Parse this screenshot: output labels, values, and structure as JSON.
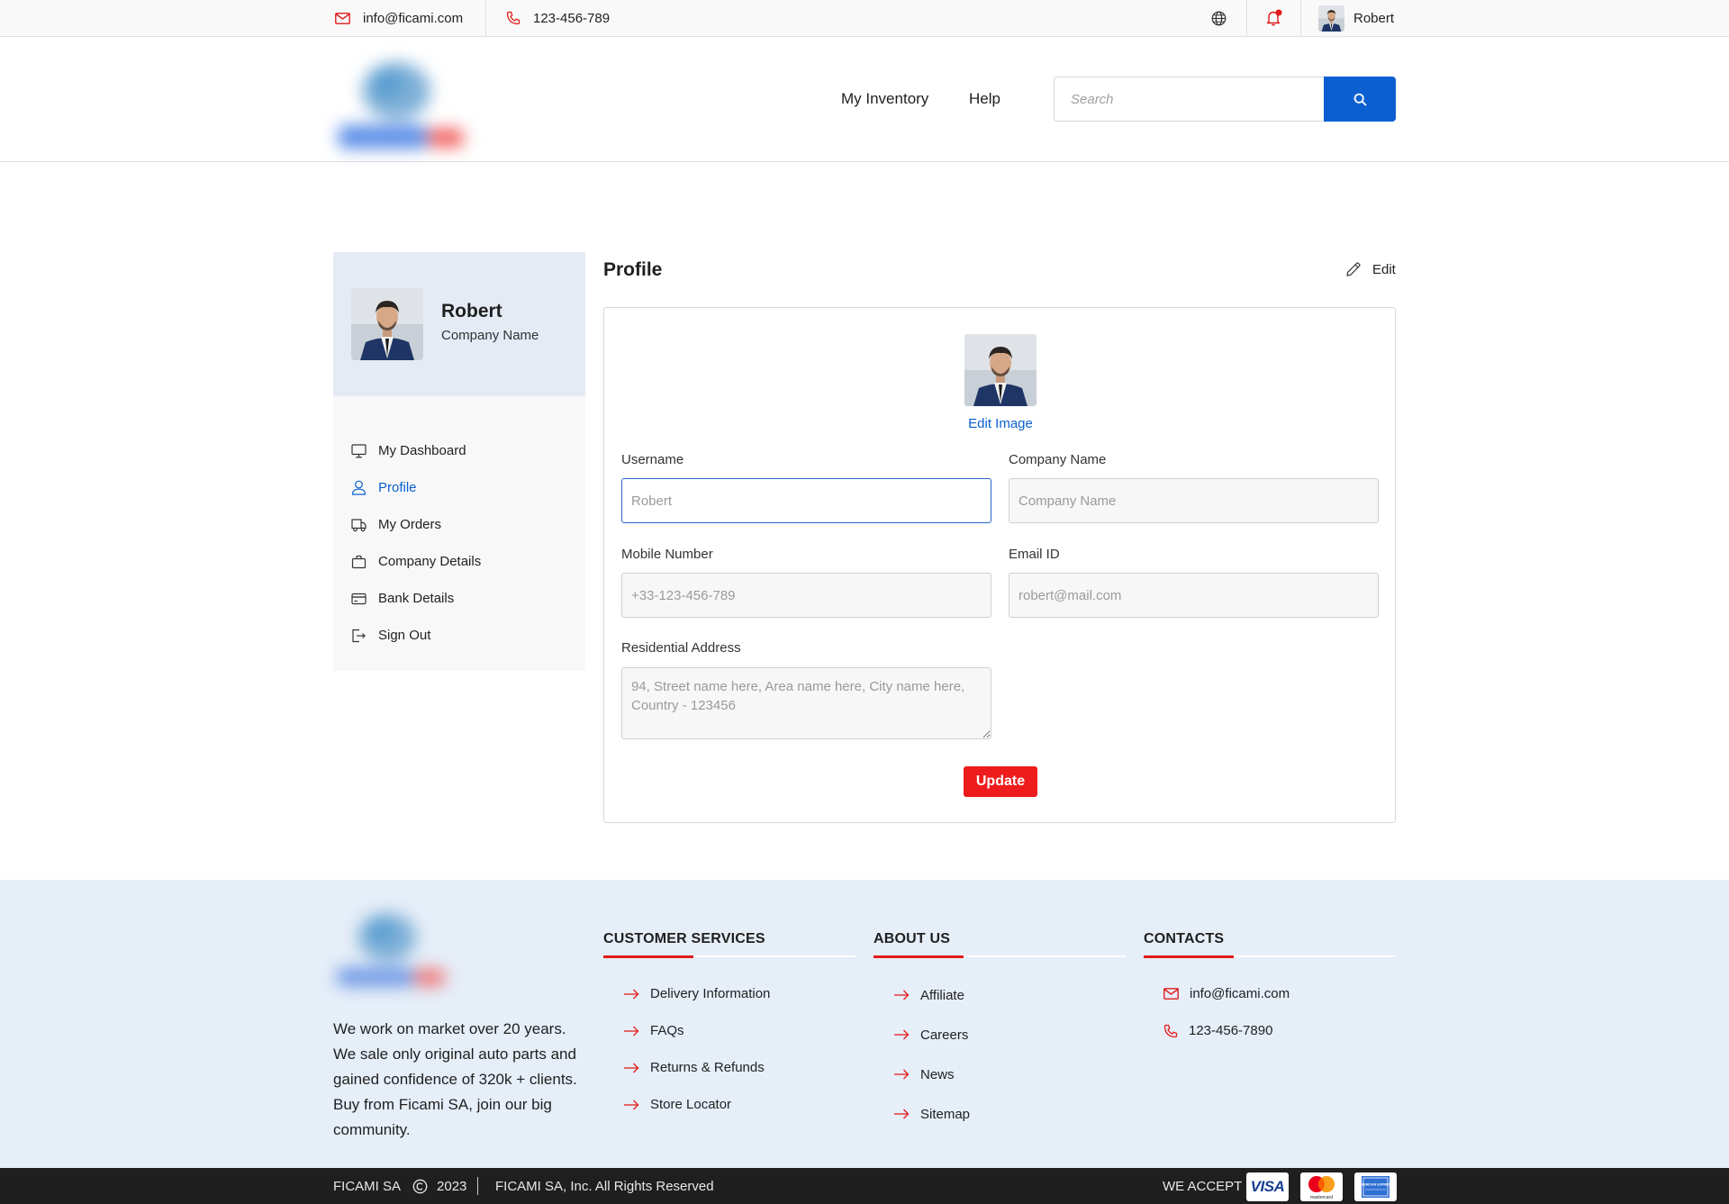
{
  "topbar": {
    "email": "info@ficami.com",
    "phone": "123-456-789",
    "user_name": "Robert"
  },
  "header": {
    "nav": [
      "My Inventory",
      "Help"
    ],
    "search_placeholder": "Search"
  },
  "sidebar": {
    "name": "Robert",
    "company": "Company Name",
    "items": [
      {
        "label": "My Dashboard",
        "icon": "monitor-icon"
      },
      {
        "label": "Profile",
        "icon": "user-icon",
        "active": true
      },
      {
        "label": "My Orders",
        "icon": "truck-icon"
      },
      {
        "label": "Company Details",
        "icon": "briefcase-icon"
      },
      {
        "label": "Bank Details",
        "icon": "credit-card-icon"
      },
      {
        "label": "Sign Out",
        "icon": "sign-out-icon"
      }
    ]
  },
  "profile": {
    "title": "Profile",
    "edit_label": "Edit",
    "edit_image_label": "Edit Image",
    "fields": {
      "username": {
        "label": "Username",
        "placeholder": "Robert"
      },
      "company": {
        "label": "Company Name",
        "placeholder": "Company Name"
      },
      "mobile": {
        "label": "Mobile Number",
        "placeholder": "+33-123-456-789"
      },
      "email": {
        "label": "Email ID",
        "placeholder": "robert@mail.com"
      },
      "address": {
        "label": "Residential Address",
        "placeholder": "94, Street name here, Area name here, City name here, Country - 123456"
      }
    },
    "update_label": "Update"
  },
  "footer": {
    "about": "We work on market over 20 years. We sale only original auto parts and gained confidence of 320k + clients. Buy from Ficami SA, join our big community.",
    "customer_services": {
      "title": "CUSTOMER SERVICES",
      "links": [
        "Delivery Information",
        "FAQs",
        "Returns & Refunds",
        "Store Locator"
      ]
    },
    "about_us": {
      "title": "ABOUT US",
      "links": [
        "Affiliate",
        "Careers",
        "News",
        "Sitemap"
      ]
    },
    "contacts": {
      "title": "CONTACTS",
      "email": "info@ficami.com",
      "phone": "123-456-7890"
    }
  },
  "bottombar": {
    "brand": "FICAMI SA",
    "year": "2023",
    "rights": "FICAMI SA, Inc. All Rights Reserved",
    "we_accept": "WE ACCEPT",
    "visa": "VISA",
    "mastercard": "mastercard",
    "amex": "AMERICAN EXPRESS"
  },
  "colors": {
    "brand_blue": "#0b5fd1",
    "accent_red": "#ee1c1c",
    "footer_bg": "#e6eef8",
    "bottom_bar": "#1f1f1f"
  }
}
